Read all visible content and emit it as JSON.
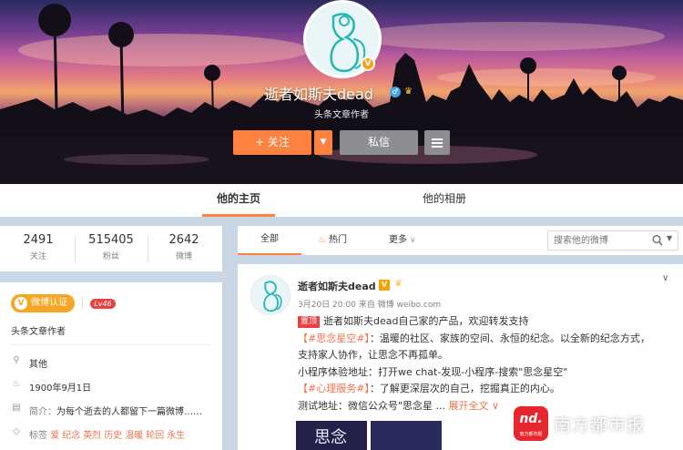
{
  "profile": {
    "name": "逝者如斯夫dead",
    "title": "头条文章作者",
    "verified_badge": "V",
    "follow_label": "关注",
    "message_label": "私信"
  },
  "tabs": {
    "home": "他的主页",
    "album": "他的相册"
  },
  "stats": [
    {
      "value": "2491",
      "label": "关注"
    },
    {
      "value": "515405",
      "label": "粉丝"
    },
    {
      "value": "2642",
      "label": "微博"
    }
  ],
  "info": {
    "verify_badge": "微博认证",
    "level": "Lv46",
    "verify_text": "头条文章作者",
    "other": "其他",
    "birthday": "1900年9月1日",
    "bio_key": "简介：",
    "bio": "为每个逝去的人都留下一篇微博……",
    "tags_key": "标签",
    "tags": [
      "爱",
      "纪念",
      "英烈",
      "历史",
      "温暖",
      "轮回",
      "永生"
    ]
  },
  "filter": {
    "all": "全部",
    "hot": "热门",
    "more": "更多",
    "search_placeholder": "搜索他的微博"
  },
  "post": {
    "name": "逝者如斯夫dead",
    "meta": "3月20日 20:00 来自 微博 weibo.com",
    "pin_label": "置顶",
    "line1": "逝者如斯夫dead自己家的产品，欢迎转发支持",
    "tag1": "【#思念星空#】",
    "line2": "：温暖的社区、家族的空间、永恒的纪念。以全新的纪念方式，",
    "line3": "支持家人协作，让思念不再孤单。",
    "line4": "小程序体验地址：打开we chat-发现-小程序-搜索\"思念星空\"",
    "tag2": "【#心理服务#】",
    "line5": "：了解更深层次的自己，挖掘真正的内心。",
    "line6": "测试地址：微信公众号\"思念星 ... ",
    "expand": "展开全文",
    "thumb_text": "思念"
  },
  "watermark": {
    "logo_text": "nd.",
    "logo_sub": "南方都市报",
    "text": "南方都市报"
  },
  "colors": {
    "accent": "#ff8140",
    "tag": "#eb7350",
    "verify": "#f5a623",
    "level": "#e84141"
  }
}
